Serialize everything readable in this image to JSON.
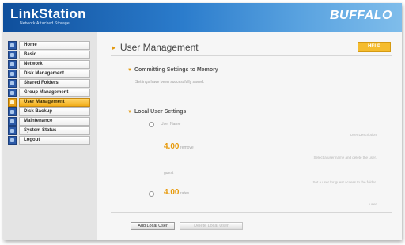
{
  "header": {
    "brand": "LinkStation",
    "tagline": "Network Attached Storage",
    "logo": "BUFFALO"
  },
  "sidebar": {
    "items": [
      {
        "label": "Home",
        "icon": "home-icon",
        "active": false
      },
      {
        "label": "Basic",
        "icon": "basic-icon",
        "active": false
      },
      {
        "label": "Network",
        "icon": "network-icon",
        "active": false
      },
      {
        "label": "Disk Management",
        "icon": "disk-icon",
        "active": false
      },
      {
        "label": "Shared Folders",
        "icon": "folder-icon",
        "active": false
      },
      {
        "label": "Group Management",
        "icon": "group-icon",
        "active": false
      },
      {
        "label": "User Management",
        "icon": "user-icon",
        "active": true
      },
      {
        "label": "Disk Backup",
        "icon": "backup-icon",
        "active": false
      },
      {
        "label": "Maintenance",
        "icon": "maintenance-icon",
        "active": false
      },
      {
        "label": "System Status",
        "icon": "status-icon",
        "active": false
      },
      {
        "label": "Logout",
        "icon": "logout-icon",
        "active": false
      }
    ]
  },
  "main": {
    "title": "User Management",
    "help_label": "HELP",
    "committing_heading": "Committing Settings to Memory",
    "committing_status": "Settings have been successfully saved.",
    "local_heading": "Local User Settings",
    "user_name_label": "User Name",
    "user_desc_label": "User Description",
    "size_value_1": "4.00",
    "size_unit_1": "remove",
    "hint_1": "Select a user name and delete the user.",
    "guest_label": "guest",
    "hint_2": "Set a user for guest access to the folder.",
    "size_value_2": "4.00",
    "size_unit_2": "rates",
    "tail_text": "user",
    "add_button": "Add Local User",
    "delete_button": "Delete Local User"
  },
  "colors": {
    "banner": "#1f66b8",
    "accent": "#e79a0c",
    "active_menu": "#f2ae19"
  }
}
